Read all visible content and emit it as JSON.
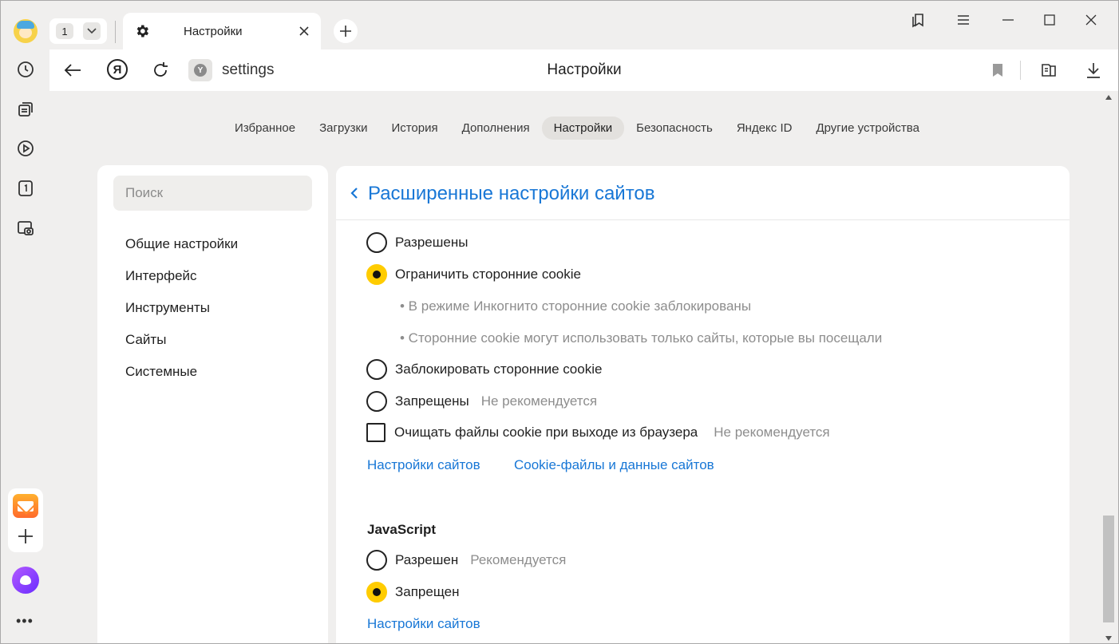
{
  "tabs": {
    "count": "1",
    "active_title": "Настройки"
  },
  "address": {
    "url": "settings",
    "page_title": "Настройки",
    "site_badge": "Y"
  },
  "settings_nav": [
    {
      "label": "Избранное",
      "active": false
    },
    {
      "label": "Загрузки",
      "active": false
    },
    {
      "label": "История",
      "active": false
    },
    {
      "label": "Дополнения",
      "active": false
    },
    {
      "label": "Настройки",
      "active": true
    },
    {
      "label": "Безопасность",
      "active": false
    },
    {
      "label": "Яндекс ID",
      "active": false
    },
    {
      "label": "Другие устройства",
      "active": false
    }
  ],
  "sidebar": {
    "search_placeholder": "Поиск",
    "items": [
      "Общие настройки",
      "Интерфейс",
      "Инструменты",
      "Сайты",
      "Системные"
    ]
  },
  "main": {
    "title": "Расширенные настройки сайтов",
    "cookies": {
      "options": [
        {
          "label": "Разрешены",
          "selected": false,
          "hint": ""
        },
        {
          "label": "Ограничить сторонние cookie",
          "selected": true,
          "hint": ""
        },
        {
          "label": "Заблокировать сторонние cookie",
          "selected": false,
          "hint": ""
        },
        {
          "label": "Запрещены",
          "selected": false,
          "hint": "Не рекомендуется"
        }
      ],
      "bullets": [
        "• В режиме Инкогнито сторонние cookie заблокированы",
        "• Сторонние cookie могут использовать только сайты, которые вы посещали"
      ],
      "clear_on_exit": {
        "label": "Очищать файлы cookie при выходе из браузера",
        "checked": false,
        "hint": "Не рекомендуется"
      },
      "links": [
        "Настройки сайтов",
        "Cookie-файлы и данные сайтов"
      ]
    },
    "javascript": {
      "title": "JavaScript",
      "options": [
        {
          "label": "Разрешен",
          "selected": false,
          "hint": "Рекомендуется"
        },
        {
          "label": "Запрещен",
          "selected": true,
          "hint": ""
        }
      ],
      "link": "Настройки сайтов"
    }
  },
  "colors": {
    "accent_link": "#1877d6",
    "radio_selected": "#ffcc00",
    "background": "#f0efee"
  }
}
